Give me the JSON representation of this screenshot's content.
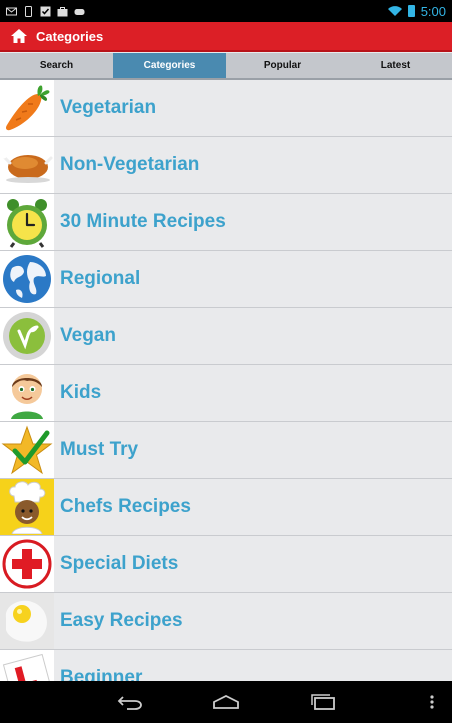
{
  "status_bar": {
    "time": "5:00"
  },
  "action_bar": {
    "title": "Categories"
  },
  "tabs": [
    {
      "label": "Search",
      "active": false
    },
    {
      "label": "Categories",
      "active": true
    },
    {
      "label": "Popular",
      "active": false
    },
    {
      "label": "Latest",
      "active": false
    }
  ],
  "categories": [
    {
      "label": "Vegetarian",
      "icon": "carrot-icon"
    },
    {
      "label": "Non-Vegetarian",
      "icon": "roast-chicken-icon"
    },
    {
      "label": "30 Minute Recipes",
      "icon": "alarm-clock-icon"
    },
    {
      "label": "Regional",
      "icon": "globe-icon"
    },
    {
      "label": "Vegan",
      "icon": "vegan-leaf-icon"
    },
    {
      "label": "Kids",
      "icon": "kid-face-icon"
    },
    {
      "label": "Must Try",
      "icon": "star-check-icon"
    },
    {
      "label": "Chefs Recipes",
      "icon": "chef-icon"
    },
    {
      "label": "Special Diets",
      "icon": "red-cross-icon"
    },
    {
      "label": "Easy Recipes",
      "icon": "fried-egg-icon"
    },
    {
      "label": "Beginner",
      "icon": "learner-l-plate-icon"
    }
  ],
  "colors": {
    "action_bar": "#dc1f26",
    "active_tab": "#4a8ab0",
    "label_text": "#3da2cc",
    "status_accent": "#33b5e5"
  }
}
